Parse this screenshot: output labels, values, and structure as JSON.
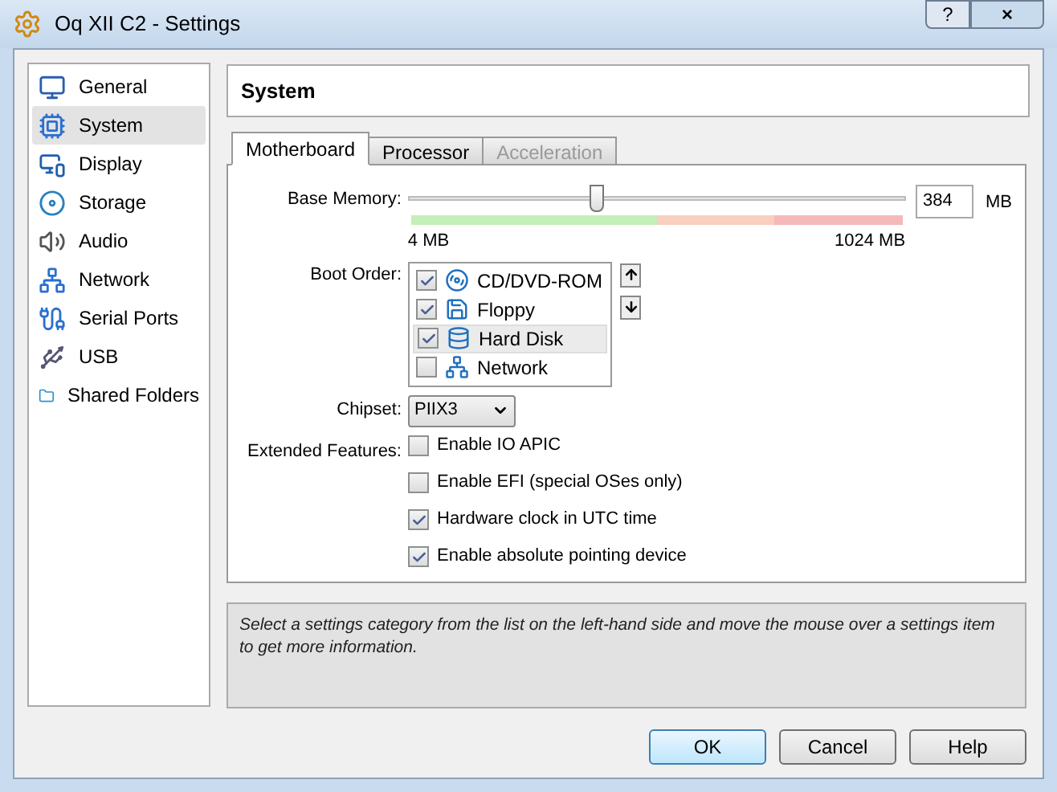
{
  "window": {
    "title": "Oq XII C2 - Settings",
    "controls": [
      "?",
      "×"
    ]
  },
  "sidebar": {
    "items": [
      {
        "label": "General",
        "selected": false
      },
      {
        "label": "System",
        "selected": true
      },
      {
        "label": "Display",
        "selected": false
      },
      {
        "label": "Storage",
        "selected": false
      },
      {
        "label": "Audio",
        "selected": false
      },
      {
        "label": "Network",
        "selected": false
      },
      {
        "label": "Serial Ports",
        "selected": false
      },
      {
        "label": "USB",
        "selected": false
      },
      {
        "label": "Shared Folders",
        "selected": false
      }
    ]
  },
  "page_title": "System",
  "tabs": [
    {
      "label": "Motherboard",
      "selected": true,
      "disabled": false
    },
    {
      "label": "Processor",
      "selected": false,
      "disabled": false
    },
    {
      "label": "Acceleration",
      "selected": false,
      "disabled": true
    }
  ],
  "base_memory": {
    "label": "Base Memory:",
    "level": 0.377,
    "min_label": "4 MB",
    "max_label": "1024 MB",
    "value": "384",
    "unit": "MB"
  },
  "boot_order": {
    "label": "Boot Order:",
    "items": [
      {
        "label": "CD/DVD-ROM",
        "checked": true,
        "selected": false,
        "kind": "optical"
      },
      {
        "label": "Floppy",
        "checked": true,
        "selected": false,
        "kind": "floppy"
      },
      {
        "label": "Hard Disk",
        "checked": true,
        "selected": true,
        "kind": "disk"
      },
      {
        "label": "Network",
        "checked": false,
        "selected": false,
        "kind": "network"
      }
    ]
  },
  "chipset": {
    "label": "Chipset:",
    "value": "PIIX3"
  },
  "extended_features": {
    "label": "Extended Features:",
    "options": [
      {
        "label": "Enable IO APIC",
        "checked": false
      },
      {
        "label": "Enable EFI (special OSes only)",
        "checked": false
      },
      {
        "label": "Hardware clock in UTC time",
        "checked": true
      },
      {
        "label": "Enable absolute pointing device",
        "checked": true
      }
    ]
  },
  "info": "Select a settings category from the list on the left-hand side and move the mouse over a settings item to get more information.",
  "buttons": [
    {
      "label": "OK",
      "default": true
    },
    {
      "label": "Cancel",
      "default": false
    },
    {
      "label": "Help",
      "default": false
    }
  ]
}
